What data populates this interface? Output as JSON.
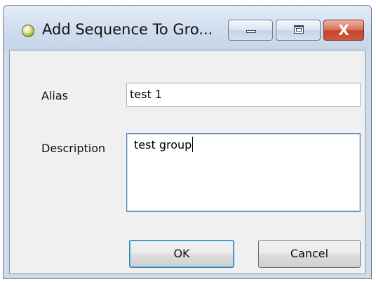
{
  "window": {
    "title": "Add Sequence To Gro...",
    "controls": {
      "minimize": "minimize",
      "maximize": "maximize",
      "close": "X"
    }
  },
  "form": {
    "alias": {
      "label": "Alias",
      "value": "test 1"
    },
    "description": {
      "label": "Description",
      "value": "test group"
    }
  },
  "buttons": {
    "ok": "OK",
    "cancel": "Cancel"
  },
  "icons": {
    "app": "app-icon",
    "minimize": "minimize-icon",
    "maximize": "maximize-icon",
    "close": "close-icon"
  },
  "colors": {
    "titlebar": "#d2def0",
    "client_background": "#f0f0f0",
    "close_button": "#c2452b",
    "focus_border": "#48b0e8"
  }
}
